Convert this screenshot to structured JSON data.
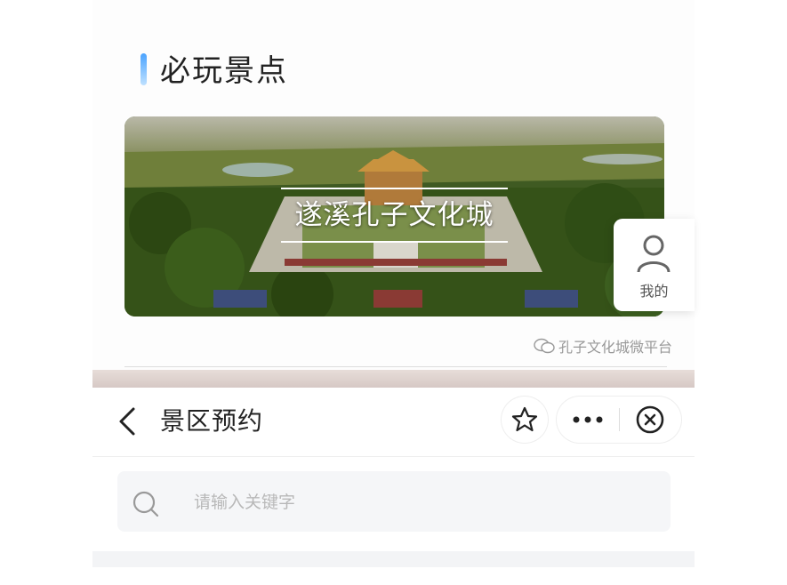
{
  "article": {
    "section_title": "必玩景点",
    "banner_caption": "遂溪孔子文化城",
    "side_button_label": "我的",
    "source_label": "孔子文化城微平台"
  },
  "miniprogram": {
    "nav_title": "景区预约",
    "search_placeholder": "请输入关键字"
  },
  "icons": {
    "back": "chevron-left-icon",
    "favorite": "star-icon",
    "more": "ellipsis-icon",
    "close": "close-circle-icon",
    "search": "search-icon",
    "user": "user-icon",
    "wechat": "wechat-icon"
  },
  "colors": {
    "title_accent": "#4aa3ff",
    "divider": "#d6c8c5"
  }
}
